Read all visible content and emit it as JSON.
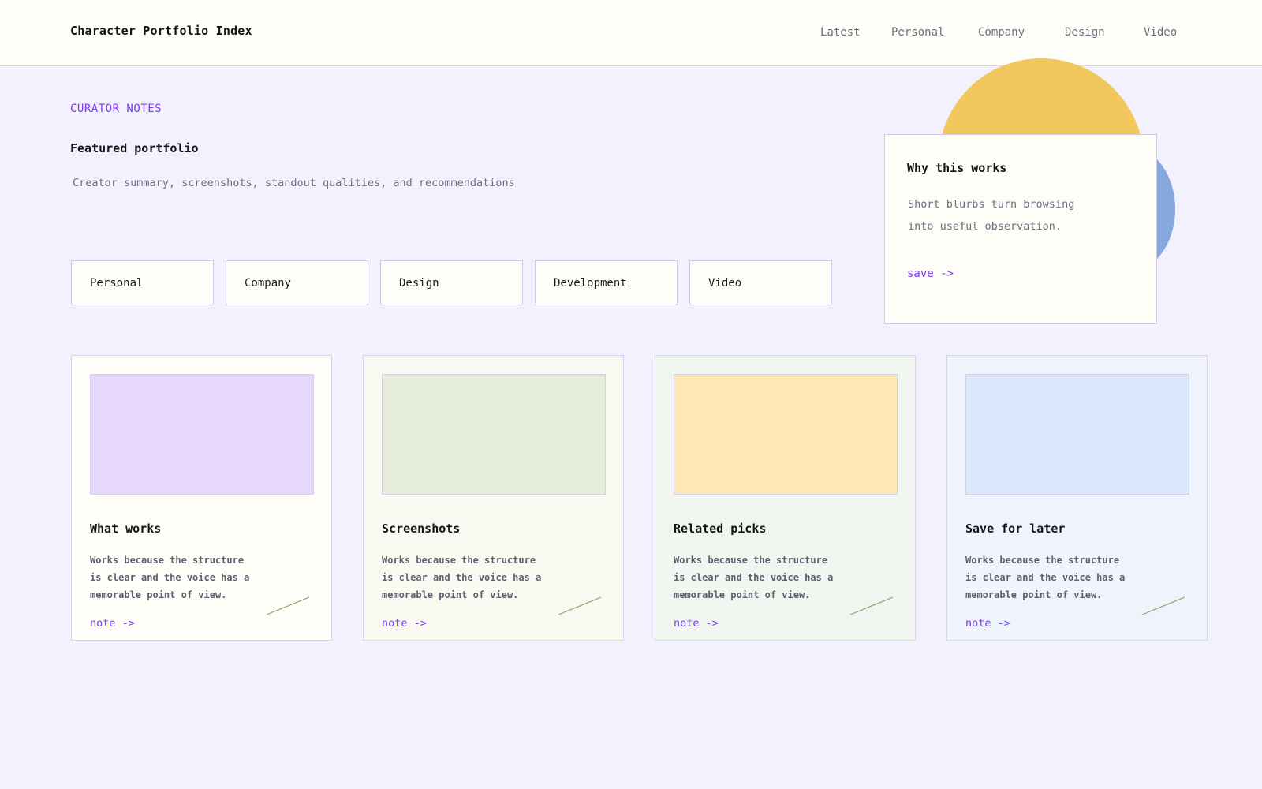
{
  "header": {
    "brand": "Character Portfolio Index",
    "nav": [
      "Latest",
      "Personal",
      "Company",
      "Design",
      "Video"
    ]
  },
  "hero": {
    "eyebrow": "CURATOR NOTES",
    "title": "Featured portfolio",
    "subtitle": "Creator summary, screenshots, standout qualities, and recommendations"
  },
  "chips": [
    "Personal",
    "Company",
    "Design",
    "Development",
    "Video"
  ],
  "aside": {
    "title": "Why this works",
    "body": "Short blurbs turn browsing into useful observation.",
    "action": "save ->"
  },
  "cards": [
    {
      "title": "What works",
      "body": "Works because the structure is clear and the voice has a memorable point of view.",
      "action": "note ->",
      "bg": "#fefdf8",
      "thumb": "#e6d8fa"
    },
    {
      "title": "Screenshots",
      "body": "Works because the structure is clear and the voice has a memorable point of view.",
      "action": "note ->",
      "bg": "#faf9f1",
      "thumb": "#e6eed9"
    },
    {
      "title": "Related picks",
      "body": "Works because the structure is clear and the voice has a memorable point of view.",
      "action": "note ->",
      "bg": "#f0f5ef",
      "thumb": "#fde7b3"
    },
    {
      "title": "Save for later",
      "body": "Works because the structure is clear and the voice has a memorable point of view.",
      "action": "note ->",
      "bg": "#eff3fc",
      "thumb": "#dbe7fa"
    }
  ],
  "colors": {
    "accent": "#7c3aed",
    "page_bg": "#f4f1ff",
    "surface": "#fefdf8",
    "decor_yellow": "#f2c85e",
    "decor_blue": "#86a8dc",
    "squiggle": "#8aa56a"
  }
}
